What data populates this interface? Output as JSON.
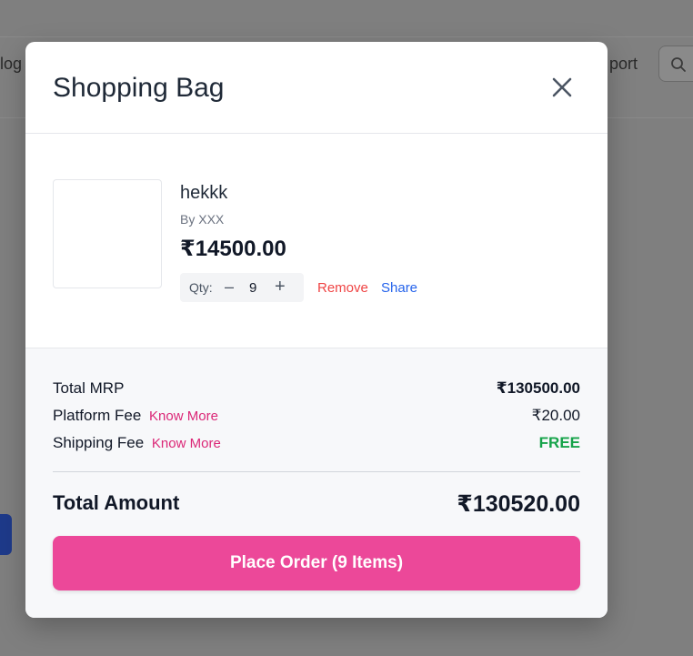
{
  "background": {
    "nav_left": "log",
    "nav_right": "port"
  },
  "modal": {
    "title": "Shopping Bag",
    "item": {
      "name": "hekkk",
      "brand": "By XXX",
      "price": "₹14500.00",
      "qty_label": "Qty:",
      "qty_minus": "–",
      "qty_value": "9",
      "qty_plus": "+",
      "remove": "Remove",
      "share": "Share"
    },
    "summary": {
      "total_mrp_label": "Total MRP",
      "total_mrp_value": "₹130500.00",
      "platform_fee_label": "Platform Fee",
      "platform_fee_link": "Know More",
      "platform_fee_value": "₹20.00",
      "shipping_fee_label": "Shipping Fee",
      "shipping_fee_link": "Know More",
      "shipping_fee_value": "FREE",
      "total_amount_label": "Total Amount",
      "total_amount_value": "₹130520.00"
    },
    "place_order": "Place Order (9 Items)"
  },
  "colors": {
    "accent": "#ec4899",
    "remove": "#ef4444",
    "share": "#2563eb",
    "free": "#16a34a"
  }
}
